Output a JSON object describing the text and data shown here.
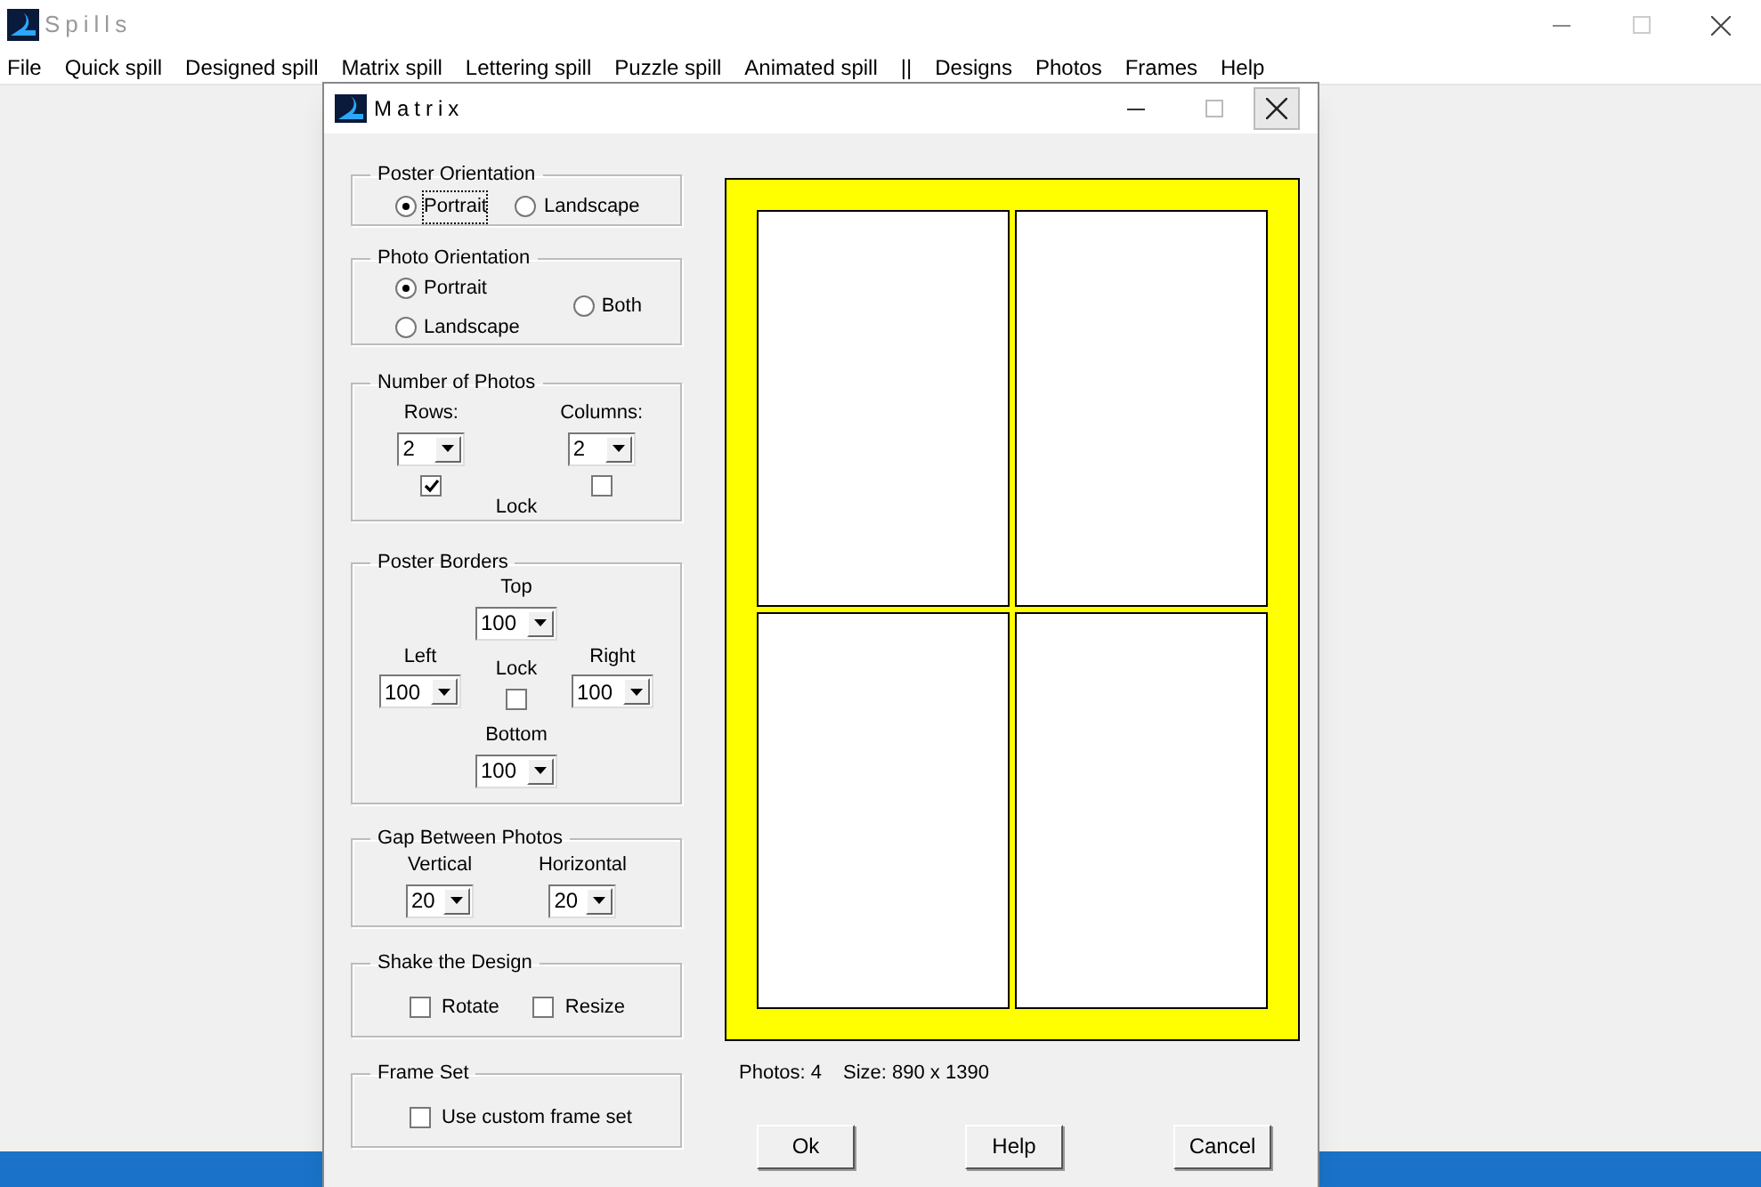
{
  "app": {
    "title": "Spills"
  },
  "menu": [
    {
      "label": "File"
    },
    {
      "label": "Quick spill"
    },
    {
      "label": "Designed spill"
    },
    {
      "label": "Matrix spill"
    },
    {
      "label": "Lettering spill"
    },
    {
      "label": "Puzzle spill"
    },
    {
      "label": "Animated spill"
    },
    {
      "label": "||"
    },
    {
      "label": "Designs"
    },
    {
      "label": "Photos"
    },
    {
      "label": "Frames"
    },
    {
      "label": "Help"
    }
  ],
  "dialog": {
    "title": "Matrix",
    "poster_orientation": {
      "label": "Poster Orientation",
      "options": [
        {
          "label": "Portrait",
          "selected": true,
          "focused": true
        },
        {
          "label": "Landscape",
          "selected": false,
          "focused": false
        }
      ]
    },
    "photo_orientation": {
      "label": "Photo Orientation",
      "options": [
        {
          "label": "Portrait",
          "selected": true
        },
        {
          "label": "Landscape",
          "selected": false
        },
        {
          "label": "Both",
          "selected": false
        }
      ]
    },
    "number_of_photos": {
      "label": "Number of Photos",
      "rows": {
        "label": "Rows:",
        "value": "2"
      },
      "columns": {
        "label": "Columns:",
        "value": "2"
      },
      "lock_label": "Lock",
      "lock_checks": [
        {
          "checked": true
        },
        {
          "checked": false
        }
      ]
    },
    "poster_borders": {
      "label": "Poster Borders",
      "top": {
        "label": "Top",
        "value": "100"
      },
      "left": {
        "label": "Left",
        "value": "100"
      },
      "right": {
        "label": "Right",
        "value": "100"
      },
      "bottom": {
        "label": "Bottom",
        "value": "100"
      },
      "lock": {
        "label": "Lock",
        "checked": false
      }
    },
    "gap_between_photos": {
      "label": "Gap Between Photos",
      "vertical": {
        "label": "Vertical",
        "value": "20"
      },
      "horizontal": {
        "label": "Horizontal",
        "value": "20"
      }
    },
    "shake_the_design": {
      "label": "Shake the Design",
      "options": [
        {
          "label": "Rotate",
          "checked": false
        },
        {
          "label": "Resize",
          "checked": false
        }
      ]
    },
    "frame_set": {
      "label": "Frame Set",
      "options": [
        {
          "label": "Use custom frame set",
          "checked": false
        }
      ]
    },
    "info": {
      "photos": "Photos: 4",
      "size": "Size: 890 x 1390"
    },
    "buttons": [
      "Ok",
      "Help",
      "Cancel"
    ]
  }
}
